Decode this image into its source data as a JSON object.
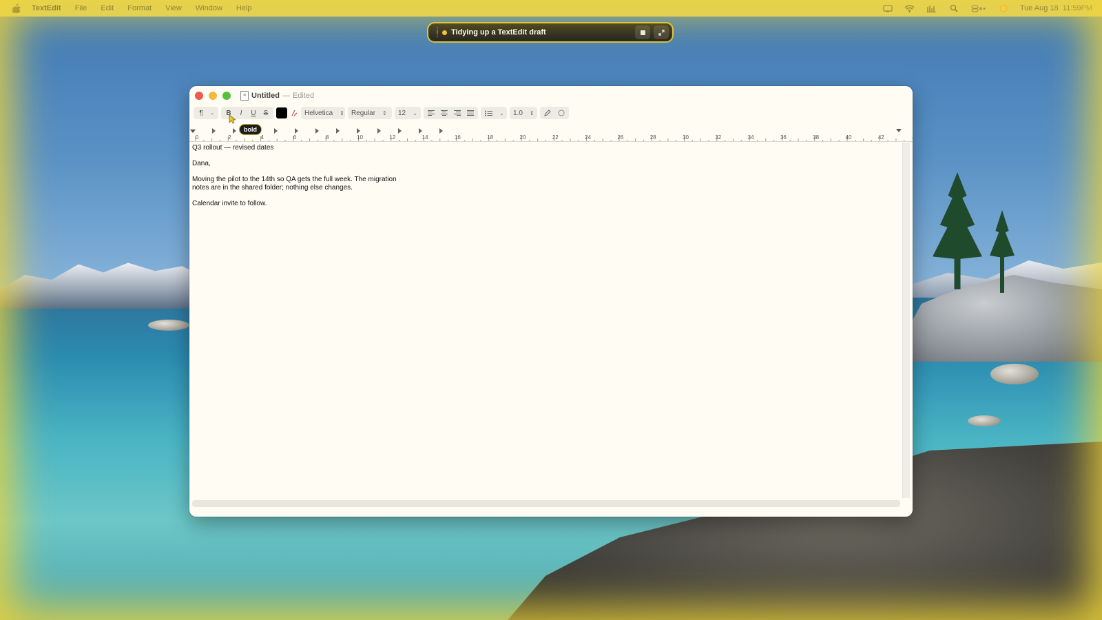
{
  "menubar": {
    "app_name": "TextEdit",
    "items": [
      "File",
      "Edit",
      "Format",
      "View",
      "Window",
      "Help"
    ],
    "clock": "Tue Aug 18  11:59PM"
  },
  "agent": {
    "title": "Tidying up a TextEdit draft"
  },
  "window": {
    "title": "Untitled",
    "separator": "—",
    "state": "Edited"
  },
  "toolbar": {
    "paragraph_glyph": "¶",
    "bold": "B",
    "italic": "I",
    "underline": "U",
    "strike": "S",
    "font": "Helvetica",
    "style": "Regular",
    "size": "12",
    "spacing": "1.0",
    "tooltip": "bold",
    "text_color": "#000000"
  },
  "ruler": {
    "labels": [
      "0",
      "2",
      "4",
      "6",
      "8",
      "10",
      "12",
      "14",
      "16",
      "18",
      "20",
      "22",
      "24",
      "26",
      "28",
      "30",
      "32",
      "34",
      "36",
      "38",
      "40",
      "42",
      "4"
    ]
  },
  "document": {
    "subject": "Q3 rollout — revised dates",
    "greeting": "Dana,",
    "body_line1": "Moving the pilot to the 14th so QA gets the full week. The migration",
    "body_line2": "notes are in the shared folder; nothing else changes.",
    "closing": "Calendar invite to follow."
  }
}
